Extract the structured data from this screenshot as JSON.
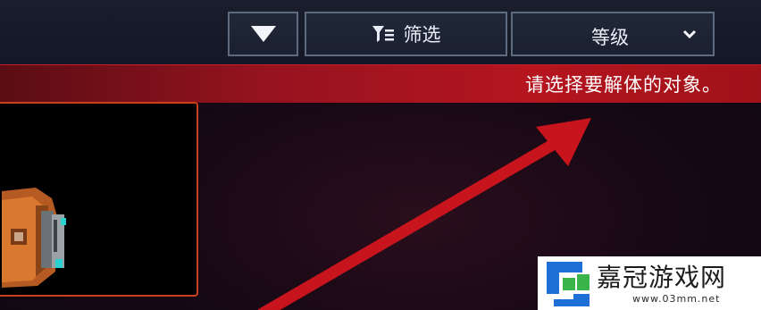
{
  "toolbar": {
    "sort_icon": "triangle-down-icon",
    "filter_label": "筛选",
    "filter_icon": "filter-icon",
    "level_label": "等级",
    "level_icon": "chevron-down-icon"
  },
  "banner": {
    "text": "请选择要解体的对象。"
  },
  "item": {
    "card": "selected-item-card"
  },
  "watermark": {
    "name": "嘉冠游戏网",
    "url": "www.03mm.net"
  },
  "colors": {
    "banner_red": "#b5151f",
    "card_border": "#c8401c",
    "button_border": "#5e6a80",
    "arrow_red": "#c8141c"
  }
}
